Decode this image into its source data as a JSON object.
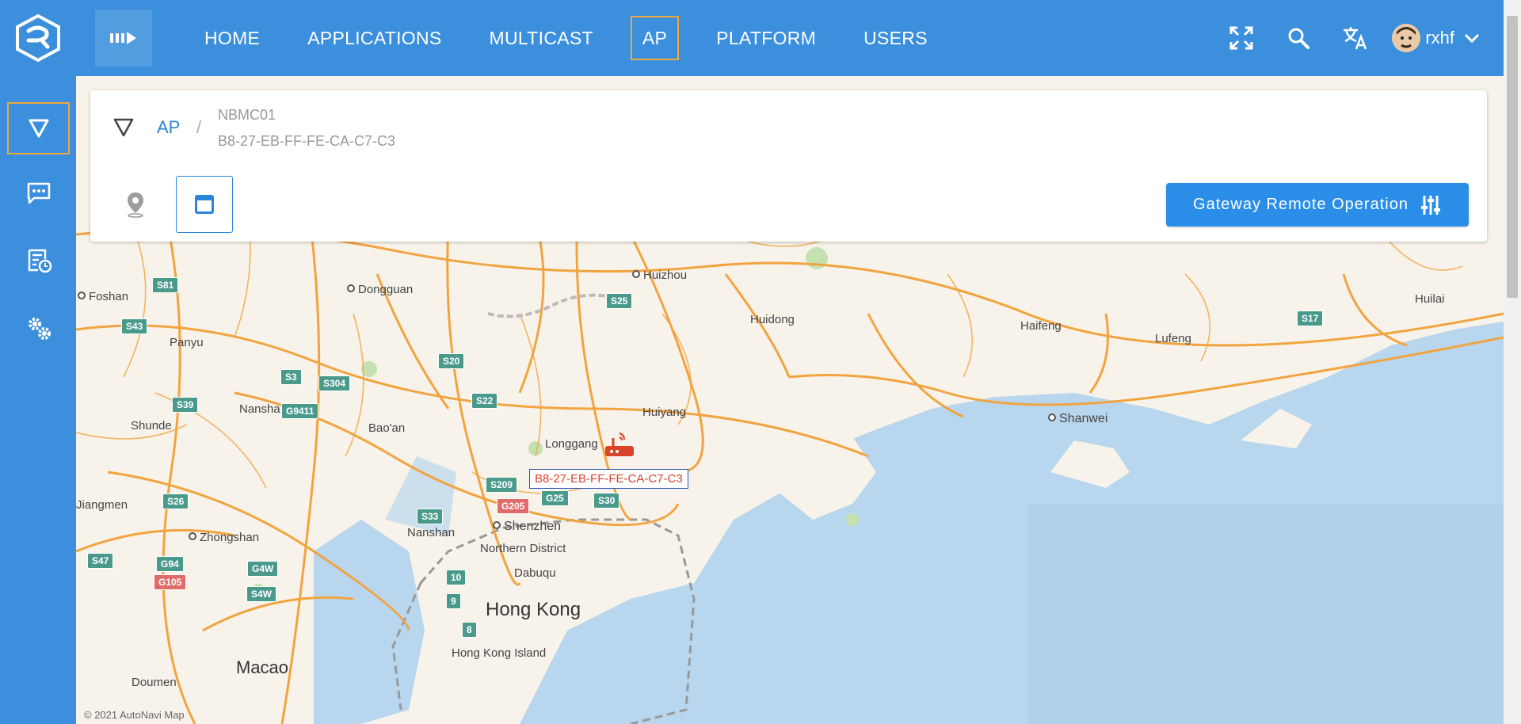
{
  "brand": {
    "logo_icon": "app-logo-icon"
  },
  "topbar": {
    "nav": [
      {
        "label": "HOME",
        "active": false
      },
      {
        "label": "APPLICATIONS",
        "active": false
      },
      {
        "label": "MULTICAST",
        "active": false
      },
      {
        "label": "AP",
        "active": true
      },
      {
        "label": "PLATFORM",
        "active": false
      },
      {
        "label": "USERS",
        "active": false
      }
    ],
    "icons": [
      "fullscreen-icon",
      "search-icon",
      "translate-icon"
    ],
    "user": {
      "name": "rxhf"
    }
  },
  "sidebar": {
    "items": [
      {
        "icon": "filter-icon",
        "active": true
      },
      {
        "icon": "message-icon",
        "active": false
      },
      {
        "icon": "schedule-list-icon",
        "active": false
      },
      {
        "icon": "settings-icon",
        "active": false
      }
    ]
  },
  "breadcrumb": {
    "root": "AP",
    "separator": "/",
    "line1": "NBMC01",
    "line2": "B8-27-EB-FF-FE-CA-C7-C3"
  },
  "panel": {
    "views": [
      {
        "icon": "location-pin-icon",
        "active": false
      },
      {
        "icon": "window-icon",
        "active": true
      }
    ],
    "gateway_button": "Gateway Remote Operation"
  },
  "map": {
    "marker_label": "B8-27-EB-FF-FE-CA-C7-C3",
    "places": [
      "Huizhou",
      "Dongguan",
      "Foshan",
      "Panyu",
      "Huidong",
      "Haifeng",
      "Lufeng",
      "Huilai",
      "Nansha",
      "Shunde",
      "Bao'an",
      "Huiyang",
      "Longgang",
      "Shanwei",
      "Jiangmen",
      "Zhongshan",
      "Nanshan",
      "Shenzhen",
      "Northern District",
      "Dabuqu",
      "Hong Kong",
      "Hong Kong Island",
      "Macao",
      "Doumen"
    ],
    "roads": [
      "S81",
      "S43",
      "S3",
      "S304",
      "S20",
      "S22",
      "S25",
      "S17",
      "S39",
      "G9411",
      "S209",
      "G205",
      "G25",
      "S30",
      "S33",
      "S26",
      "S47",
      "G94",
      "G105",
      "G4W",
      "S4W",
      "10",
      "9",
      "8"
    ]
  },
  "colors": {
    "primary": "#3b8fdc",
    "accent": "#f0a73c",
    "button": "#2a8ee8"
  }
}
